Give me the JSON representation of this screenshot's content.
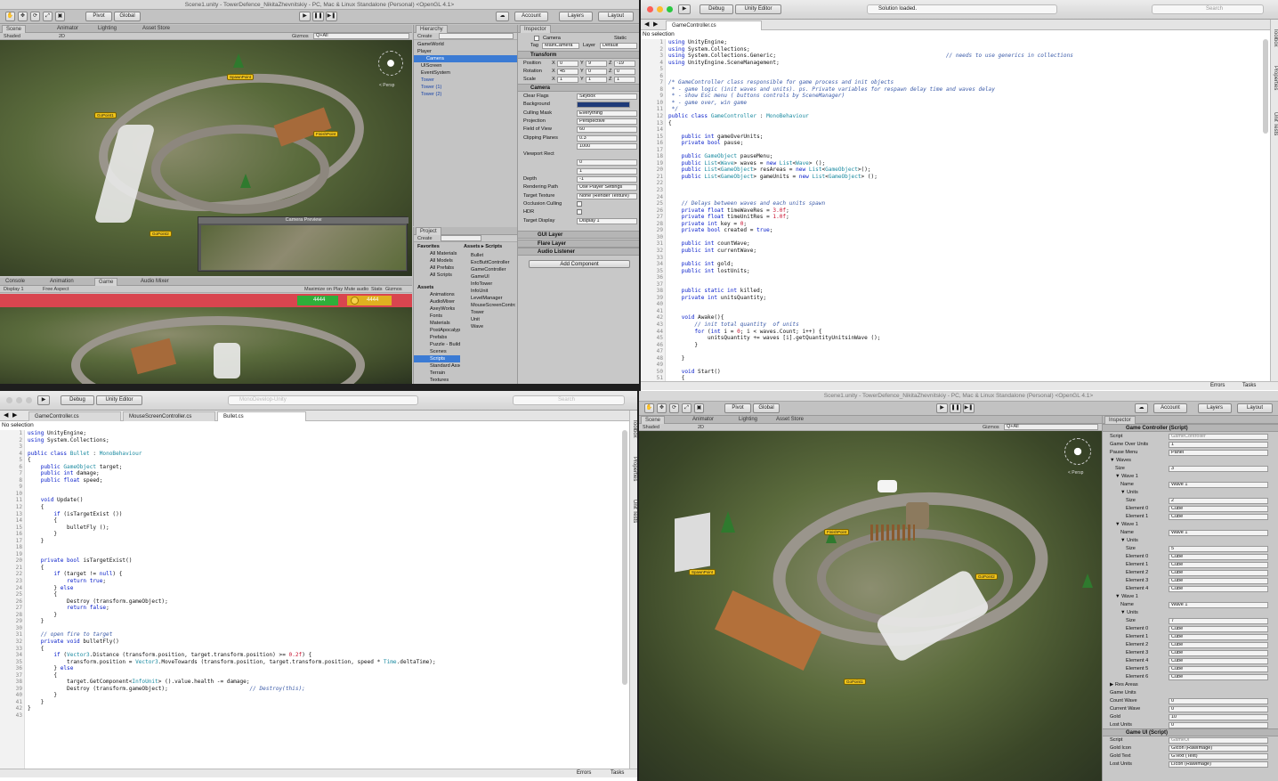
{
  "unity_tl": {
    "window_title": "Scene1.unity - TowerDefence_NikitaZhevnitskiy - PC, Mac & Linux Standalone (Personal) <OpenGL 4.1>",
    "pivot": "Pivot",
    "global": "Global",
    "account": "Account",
    "layers": "Layers",
    "layout": "Layout",
    "tabs_top": [
      "Scene",
      "Animator",
      "Lighting",
      "Asset Store"
    ],
    "scene_bar": {
      "shaded": "Shaded",
      "mode2d": "2D",
      "gizmos": "Gizmos",
      "search": "Q+All"
    },
    "persp": "< Persp",
    "markers": [
      "GoPoint1",
      "SpawnPoint",
      "FinishPoint",
      "GoPoint2"
    ],
    "camera_preview": "Camera Preview",
    "tabs_bottom": [
      "Console",
      "Animation",
      "Game",
      "Audio Mixer"
    ],
    "game_bar": {
      "display": "Display 1",
      "aspect": "Free Aspect",
      "maximize": "Maximize on Play",
      "mute": "Mute audio",
      "stats": "Stats",
      "gizmos": "Gizmos"
    },
    "hud": {
      "units": "4444",
      "gold": "4444"
    },
    "hierarchy": {
      "title": "Hierarchy",
      "create": "Create",
      "items": [
        "GameWorld",
        "Player",
        "Camera",
        "UIScreen",
        "EventSystem",
        "Tower",
        "Tower (1)",
        "Tower (2)"
      ]
    },
    "project": {
      "title": "Project",
      "create": "Create",
      "favorites_label": "Favorites",
      "favorites": [
        "All Materials",
        "All Models",
        "All Prefabs",
        "All Scripts"
      ],
      "assets_label": "Assets",
      "assets_tree": [
        "Animations",
        "AudioMixer",
        "AxeyWorks",
        "Fonts",
        "Materials",
        "PostApocalypse",
        "Prefabs",
        "Puzzle - Buildings",
        "Scenes",
        "Scripts",
        "Standard Assets",
        "Terrain",
        "Textures"
      ],
      "breadcrumb": "Assets ▸ Scripts",
      "scripts": [
        "Bullet",
        "ExcButtController",
        "GameController",
        "GameUI",
        "InfoTower",
        "InfoUnit",
        "LevelManager",
        "MouseScreenController",
        "Tower",
        "Unit",
        "Wave"
      ]
    },
    "inspector": {
      "title": "Inspector",
      "object_name": "Camera",
      "static": "Static",
      "tag_label": "Tag",
      "tag_value": "MainCamera",
      "layer_label": "Layer",
      "layer_value": "Default",
      "transform": {
        "title": "Transform",
        "rows": [
          {
            "label": "Position",
            "x": "0",
            "y": "9",
            "z": "-19"
          },
          {
            "label": "Rotation",
            "x": "45",
            "y": "0",
            "z": "0"
          },
          {
            "label": "Scale",
            "x": "1",
            "y": "1",
            "z": "1"
          }
        ]
      },
      "camera": {
        "title": "Camera",
        "rows": [
          {
            "label": "Clear Flags",
            "value": "Skybox"
          },
          {
            "label": "Background",
            "value": ""
          },
          {
            "label": "Culling Mask",
            "value": "Everything"
          },
          {
            "label": "Projection",
            "value": "Perspective"
          },
          {
            "label": "Field of View",
            "value": "60"
          },
          {
            "label": "Clipping Planes",
            "value": "0.3"
          },
          {
            "label": "",
            "value": "1000"
          },
          {
            "label": "Viewport Rect",
            "value": ""
          },
          {
            "label": "",
            "value": "0"
          },
          {
            "label": "",
            "value": "1"
          },
          {
            "label": "Depth",
            "value": "-1"
          },
          {
            "label": "Rendering Path",
            "value": "Use Player Settings"
          },
          {
            "label": "Target Texture",
            "value": "None (Render Texture)"
          },
          {
            "label": "Occlusion Culling",
            "value": ""
          },
          {
            "label": "HDR",
            "value": ""
          },
          {
            "label": "Target Display",
            "value": "Display 1"
          }
        ],
        "near": "Near",
        "far": "Far"
      },
      "components": [
        "GUI Layer",
        "Flare Layer",
        "Audio Listener"
      ],
      "add_component": "Add Component"
    }
  },
  "editor_tr": {
    "debug": "Debug",
    "target": "Unity Editor",
    "status": "Solution loaded.",
    "search": "Search",
    "tab": "GameController.cs",
    "no_selection": "No selection",
    "side_tabs": [
      "Toolbox",
      "Properties",
      "Unit Tests"
    ],
    "errors": "Errors",
    "tasks": "Tasks"
  },
  "editor_bl": {
    "debug": "Debug",
    "target": "Unity Editor",
    "title_center": "MonoDevelop-Unity",
    "search": "Search",
    "tabs": [
      "GameController.cs",
      "MouseScreenController.cs",
      "Bullet.cs"
    ],
    "no_selection": "No selection",
    "side_tabs": [
      "Toolbox",
      "Properties",
      "Unit Tests"
    ],
    "errors": "Errors",
    "tasks": "Tasks"
  },
  "unity_br": {
    "window_title": "Scene1.unity - TowerDefence_NikitaZhevnitskiy - PC, Mac & Linux Standalone (Personal) <OpenGL 4.1>",
    "pivot": "Pivot",
    "global": "Global",
    "account": "Account",
    "layers": "Layers",
    "layout": "Layout",
    "tabs_top": [
      "Scene",
      "Animator",
      "Lighting",
      "Asset Store"
    ],
    "scene_bar": {
      "shaded": "Shaded",
      "mode2d": "2D",
      "gizmos": "Gizmos",
      "search": "Q+All"
    },
    "persp": "< Persp",
    "markers": [
      "FinishPoint",
      "SpawnPoint",
      "GoPoint2",
      "GoPoint1"
    ],
    "inspector": {
      "title": "Inspector",
      "component": "Game Controller (Script)",
      "rows": [
        {
          "label": "Script",
          "value": "GameController",
          "indent": 0
        },
        {
          "label": "Game Over Units",
          "value": "1",
          "indent": 0
        },
        {
          "label": "Pause Menu",
          "value": "Panel",
          "indent": 0
        },
        {
          "label": "▼ Waves",
          "value": "",
          "indent": 0
        },
        {
          "label": "Size",
          "value": "3",
          "indent": 1
        },
        {
          "label": "▼ Wave 1",
          "value": "",
          "indent": 1
        },
        {
          "label": "Name",
          "value": "Wave 1",
          "indent": 2
        },
        {
          "label": "▼ Units",
          "value": "",
          "indent": 2
        },
        {
          "label": "Size",
          "value": "2",
          "indent": 3
        },
        {
          "label": "Element 0",
          "value": "Cube",
          "indent": 3
        },
        {
          "label": "Element 1",
          "value": "Cube",
          "indent": 3
        },
        {
          "label": "▼ Wave 1",
          "value": "",
          "indent": 1
        },
        {
          "label": "Name",
          "value": "Wave 1",
          "indent": 2
        },
        {
          "label": "▼ Units",
          "value": "",
          "indent": 2
        },
        {
          "label": "Size",
          "value": "5",
          "indent": 3
        },
        {
          "label": "Element 0",
          "value": "Cube",
          "indent": 3
        },
        {
          "label": "Element 1",
          "value": "Cube",
          "indent": 3
        },
        {
          "label": "Element 2",
          "value": "Cube",
          "indent": 3
        },
        {
          "label": "Element 3",
          "value": "Cube",
          "indent": 3
        },
        {
          "label": "Element 4",
          "value": "Cube",
          "indent": 3
        },
        {
          "label": "▼ Wave 1",
          "value": "",
          "indent": 1
        },
        {
          "label": "Name",
          "value": "Wave 1",
          "indent": 2
        },
        {
          "label": "▼ Units",
          "value": "",
          "indent": 2
        },
        {
          "label": "Size",
          "value": "7",
          "indent": 3
        },
        {
          "label": "Element 0",
          "value": "Cube",
          "indent": 3
        },
        {
          "label": "Element 1",
          "value": "Cube",
          "indent": 3
        },
        {
          "label": "Element 2",
          "value": "Cube",
          "indent": 3
        },
        {
          "label": "Element 3",
          "value": "Cube",
          "indent": 3
        },
        {
          "label": "Element 4",
          "value": "Cube",
          "indent": 3
        },
        {
          "label": "Element 5",
          "value": "Cube",
          "indent": 3
        },
        {
          "label": "Element 6",
          "value": "Cube",
          "indent": 3
        },
        {
          "label": "▶ Res Areas",
          "value": "",
          "indent": 0
        },
        {
          "label": "Game Units",
          "value": "",
          "indent": 0
        },
        {
          "label": "Count Wave",
          "value": "0",
          "indent": 0
        },
        {
          "label": "Current Wave",
          "value": "0",
          "indent": 0
        },
        {
          "label": "Gold",
          "value": "10",
          "indent": 0
        },
        {
          "label": "Lost Units",
          "value": "0",
          "indent": 0
        }
      ],
      "component2": "Game UI (Script)",
      "rows2": [
        {
          "label": "Script",
          "value": "GameUI"
        },
        {
          "label": "Gold Icon",
          "value": "GIcon (RawImage)"
        },
        {
          "label": "Gold Text",
          "value": "GText (Text)"
        },
        {
          "label": "Lost Units",
          "value": "LIcon (RawImage)"
        }
      ]
    }
  },
  "colors": {
    "accent": "#3b7bd4",
    "hud_red": "#d9454f",
    "hud_green": "#2fae3a",
    "hud_gold": "#e0b020",
    "marker": "#f0c419"
  }
}
